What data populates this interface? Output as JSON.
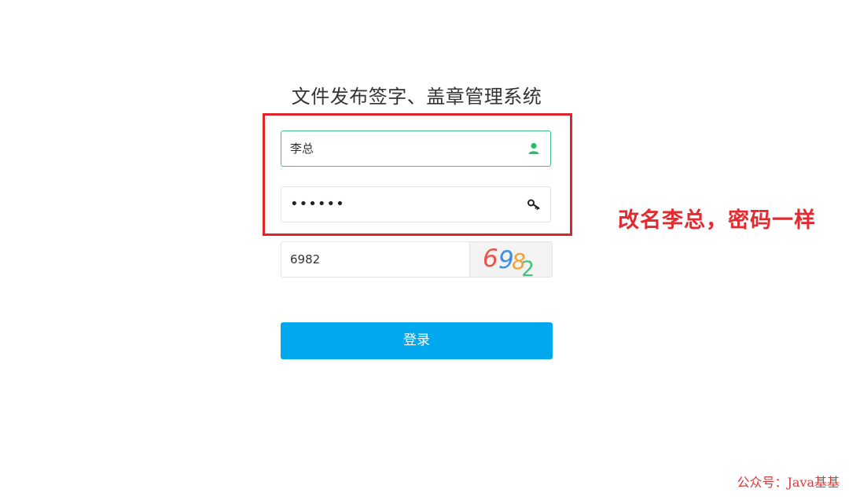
{
  "app": {
    "title": "文件发布签字、盖章管理系统"
  },
  "login_form": {
    "username": {
      "value": "李总",
      "icon": "user-icon"
    },
    "password": {
      "value": "••••••",
      "icon": "key-icon"
    },
    "captcha": {
      "value": "6982",
      "image_text": "6982"
    },
    "submit_label": "登录"
  },
  "annotation": {
    "text": "改名李总，密码一样"
  },
  "watermark": {
    "text": "公众号：Java基基"
  },
  "colors": {
    "accent_green": "#3fc27f",
    "button_blue": "#02a8ee",
    "annotation_red": "#e32a2f"
  }
}
